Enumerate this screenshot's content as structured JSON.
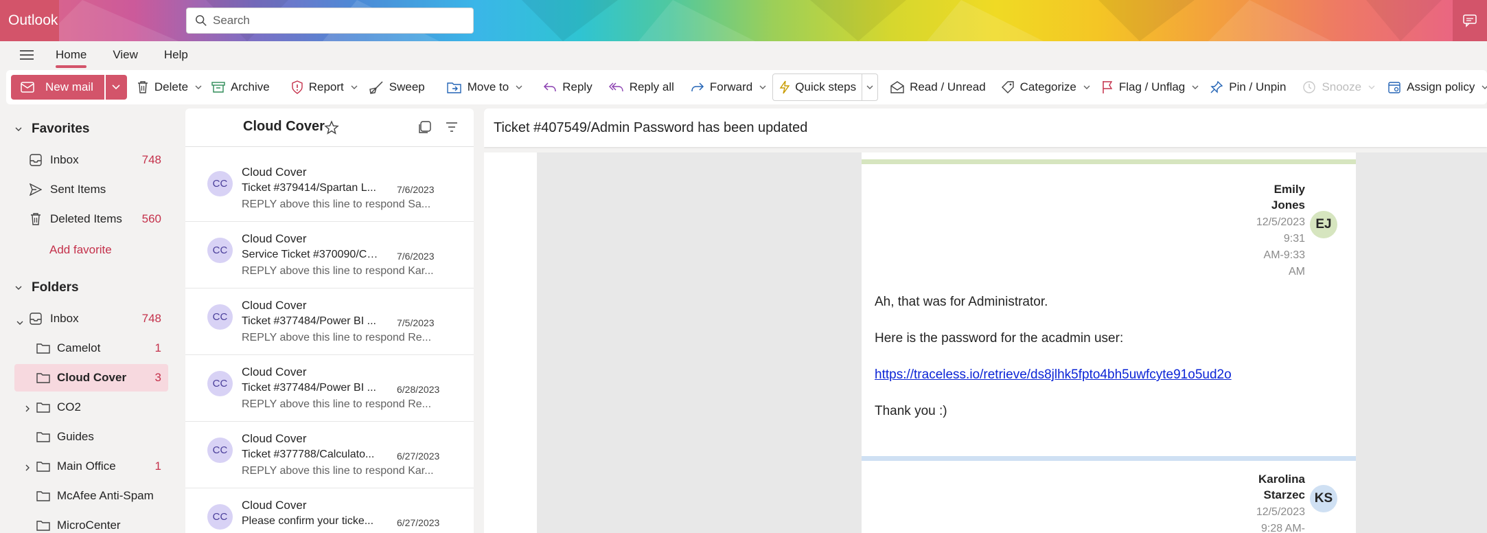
{
  "app": {
    "name": "Outlook"
  },
  "search": {
    "placeholder": "Search"
  },
  "menu_tabs": [
    {
      "label": "Home",
      "active": true
    },
    {
      "label": "View",
      "active": false
    },
    {
      "label": "Help",
      "active": false
    }
  ],
  "ribbon": {
    "new_mail": "New mail",
    "delete": "Delete",
    "archive": "Archive",
    "report": "Report",
    "sweep": "Sweep",
    "move_to": "Move to",
    "reply": "Reply",
    "reply_all": "Reply all",
    "forward": "Forward",
    "quick_steps": "Quick steps",
    "read_unread": "Read / Unread",
    "categorize": "Categorize",
    "flag_unflag": "Flag / Unflag",
    "pin_unpin": "Pin / Unpin",
    "snooze": "Snooze",
    "assign_policy": "Assign policy"
  },
  "favorites": {
    "title": "Favorites",
    "items": [
      {
        "label": "Inbox",
        "count": "748"
      },
      {
        "label": "Sent Items",
        "count": ""
      },
      {
        "label": "Deleted Items",
        "count": "560"
      }
    ],
    "add_favorite": "Add favorite"
  },
  "folders": {
    "title": "Folders",
    "inbox": {
      "label": "Inbox",
      "count": "748"
    },
    "items": [
      {
        "label": "Camelot",
        "count": "1"
      },
      {
        "label": "Cloud Cover",
        "count": "3"
      },
      {
        "label": "CO2",
        "count": ""
      },
      {
        "label": "Guides",
        "count": ""
      },
      {
        "label": "Main Office",
        "count": "1"
      },
      {
        "label": "McAfee Anti-Spam",
        "count": ""
      },
      {
        "label": "MicroCenter",
        "count": ""
      }
    ]
  },
  "message_list": {
    "title": "Cloud Cover",
    "messages": [
      {
        "initials": "CC",
        "from": "Cloud Cover",
        "subject": "Ticket #379414/Spartan L...",
        "date": "7/6/2023",
        "preview": "REPLY above this line to respond Sa..."
      },
      {
        "initials": "CC",
        "from": "Cloud Cover",
        "subject": "Service Ticket #370090/Ca...",
        "date": "7/6/2023",
        "preview": "REPLY above this line to respond Kar..."
      },
      {
        "initials": "CC",
        "from": "Cloud Cover",
        "subject": "Ticket #377484/Power BI ...",
        "date": "7/5/2023",
        "preview": "REPLY above this line to respond Re..."
      },
      {
        "initials": "CC",
        "from": "Cloud Cover",
        "subject": "Ticket #377484/Power BI ...",
        "date": "6/28/2023",
        "preview": "REPLY above this line to respond Re..."
      },
      {
        "initials": "CC",
        "from": "Cloud Cover",
        "subject": "Ticket #377788/Calculato...",
        "date": "6/27/2023",
        "preview": "REPLY above this line to respond Kar..."
      },
      {
        "initials": "CC",
        "from": "Cloud Cover",
        "subject": "Please confirm your ticke...",
        "date": "6/27/2023",
        "preview": ""
      }
    ]
  },
  "reading": {
    "subject": "Ticket #407549/Admin Password has been updated",
    "msg1": {
      "sender_line1": "Emily",
      "sender_line2": "Jones",
      "initials": "EJ",
      "time_lines": [
        "12/5/2023",
        "9:31",
        "AM-9:33",
        "AM"
      ],
      "body": [
        "Ah, that was for Administrator.",
        "Here is the password for the acadmin user:",
        "https://traceless.io/retrieve/ds8jlhk5fpto4bh5uwfcyte91o5ud2o",
        "Thank you :)"
      ]
    },
    "msg2": {
      "sender_line1": "Karolina",
      "sender_line2": "Starzec",
      "initials": "KS",
      "time_lines": [
        "12/5/2023",
        "9:28 AM-"
      ]
    }
  },
  "colors": {
    "brand": "#d3546a",
    "unread_count": "#c4314b",
    "selected_folder": "#f7d9df",
    "avatar_cc": "#d8d2f5",
    "avatar_ej": "#d6e5bf",
    "avatar_ks": "#cfe0f3",
    "link": "#0b24d6"
  }
}
